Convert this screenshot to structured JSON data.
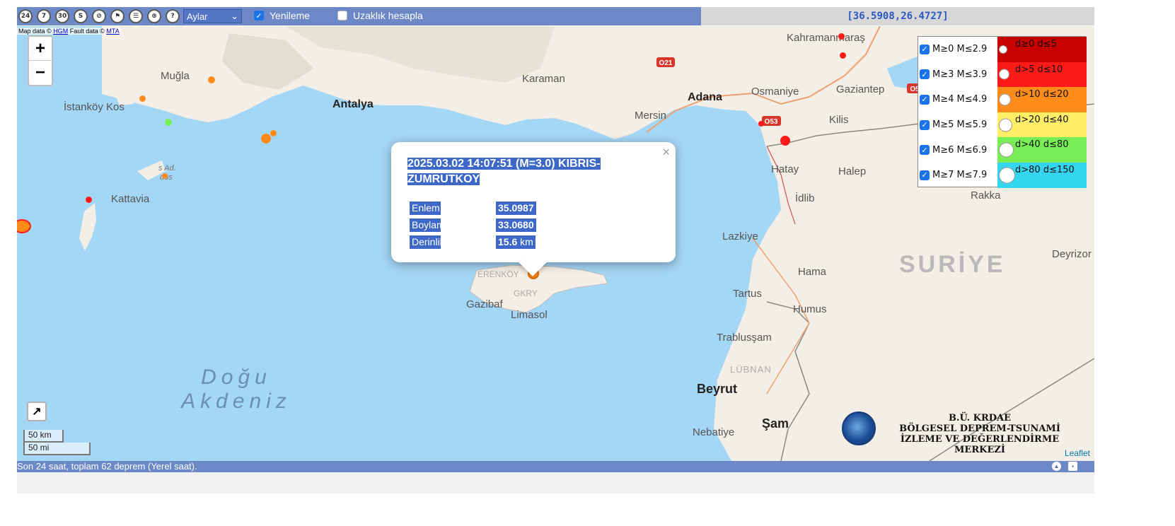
{
  "toolbar": {
    "buttons": [
      {
        "label": "24",
        "icon": "last-24h-icon"
      },
      {
        "label": "7",
        "icon": "last-7-days-icon"
      },
      {
        "label": "30",
        "icon": "last-30-days-icon"
      },
      {
        "label": "S",
        "icon": "search-s-icon"
      },
      {
        "label": "⊘",
        "icon": "fault-lines-icon"
      },
      {
        "label": "⚑",
        "icon": "flag-icon"
      },
      {
        "label": "☰",
        "icon": "list-icon"
      },
      {
        "label": "⊕",
        "icon": "locate-icon"
      },
      {
        "label": "?",
        "icon": "help-icon"
      }
    ],
    "period_select": "Aylar",
    "refresh_label": "Yenileme",
    "refresh_checked": true,
    "distance_label": "Uzaklık hesapla",
    "distance_checked": false,
    "coordinates": "[36.5908,26.4727]"
  },
  "map": {
    "attribution_prefix": "Map data ©",
    "attribution_hgm": "HGM",
    "attribution_fault": "Fault data ©",
    "attribution_mta": "MTA",
    "zoom_in": "+",
    "zoom_out": "−",
    "scale_km": "50 km",
    "scale_mi": "50 mi",
    "places": {
      "mugla": "Muğla",
      "istankoy": "İstanköy Kos",
      "antalya": "Antalya",
      "karaman": "Karaman",
      "mersin": "Mersin",
      "adana": "Adana",
      "osmaniye": "Osmaniye",
      "kahramanmaras": "Kahramanmaraş",
      "gaziantep": "Gaziantep",
      "kilis": "Kilis",
      "hatay": "Hatay",
      "halep": "Halep",
      "idlib": "İdlib",
      "rakka": "Rakka",
      "kattavia": "Kattavia",
      "lazkiye": "Lazkiye",
      "hama": "Hama",
      "tartus": "Tartus",
      "humus": "Humus",
      "deyrizor": "Deyrizor",
      "trablussam": "Trablusşam",
      "lubnan": "LÜBNAN",
      "beyrut": "Beyrut",
      "sam": "Şam",
      "nebatiye": "Nebatiye",
      "gazibaf": "Gazibaf",
      "limasol": "Limasol",
      "gkry": "GKRY",
      "erenkoy": "ERENKÖY",
      "rodos": "s Ad.",
      "rodos2": "dos"
    },
    "sea_name_line1": "Doğu",
    "sea_name_line2": "Akdeniz",
    "country_syria": "SURİYE",
    "road_o21": "O21",
    "road_o53": "O53",
    "road_o5": "O5"
  },
  "legend": {
    "magnitudes": [
      {
        "label": "M≥0  M≤2.9",
        "checked": true
      },
      {
        "label": "M≥3  M≤3.9",
        "checked": true
      },
      {
        "label": "M≥4  M≤4.9",
        "checked": true
      },
      {
        "label": "M≥5  M≤5.9",
        "checked": true
      },
      {
        "label": "M≥6  M≤6.9",
        "checked": true
      },
      {
        "label": "M≥7  M≤7.9",
        "checked": true
      }
    ],
    "depths": [
      {
        "label": "d≥0   d≤5",
        "color": "#c80000"
      },
      {
        "label": "d>5   d≤10",
        "color": "#ff1a1a"
      },
      {
        "label": "d>10  d≤20",
        "color": "#ff8c1a"
      },
      {
        "label": "d>20  d≤40",
        "color": "#ffee66"
      },
      {
        "label": "d>40  d≤80",
        "color": "#77ee55"
      },
      {
        "label": "d>80 d≤150",
        "color": "#33d6ee"
      }
    ]
  },
  "popup": {
    "title": "2025.03.02 14:07:51 (M=3.0) KIBRIS-ZUMRUTKOY",
    "close": "×",
    "rows": [
      {
        "key": "Enlem",
        "value": "35.0987",
        "unit": ""
      },
      {
        "key": "Boylam",
        "value": "33.0680",
        "unit": ""
      },
      {
        "key": "Derinlik",
        "value": "15.6",
        "unit": "km"
      }
    ]
  },
  "logo": {
    "line1": "B.Ü. KRDAE",
    "line2": "BÖLGESEL DEPREM-TSUNAMİ",
    "line3": "İZLEME VE DEĞERLENDİRME MERKEZİ"
  },
  "leaflet_label": "Leaflet",
  "status": "Son 24 saat, toplam 62 deprem (Yerel saat)."
}
